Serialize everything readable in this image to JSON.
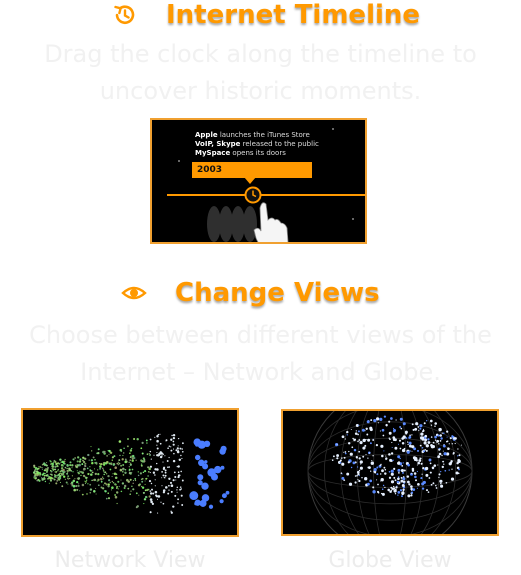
{
  "section_timeline": {
    "icon": "history-icon",
    "title": "Internet Timeline",
    "description": "Drag the clock along the timeline to uncover historic moments.",
    "preview": {
      "events": [
        {
          "bold": "Apple",
          "rest": " launches the iTunes Store"
        },
        {
          "bold": "VoIP, Skype",
          "rest": " released to the public"
        },
        {
          "bold": "MySpace",
          "rest": " opens its doors"
        }
      ],
      "year": "2003"
    }
  },
  "section_views": {
    "icon": "eye-icon",
    "title": "Change Views",
    "description": "Choose between different views of the Internet – Network and Globe.",
    "views": [
      {
        "caption": "Network View"
      },
      {
        "caption": "Globe View"
      }
    ]
  },
  "colors": {
    "accent": "#ff9900",
    "frame_border": "#f0a030",
    "faded_text": "#f1f1f1"
  }
}
